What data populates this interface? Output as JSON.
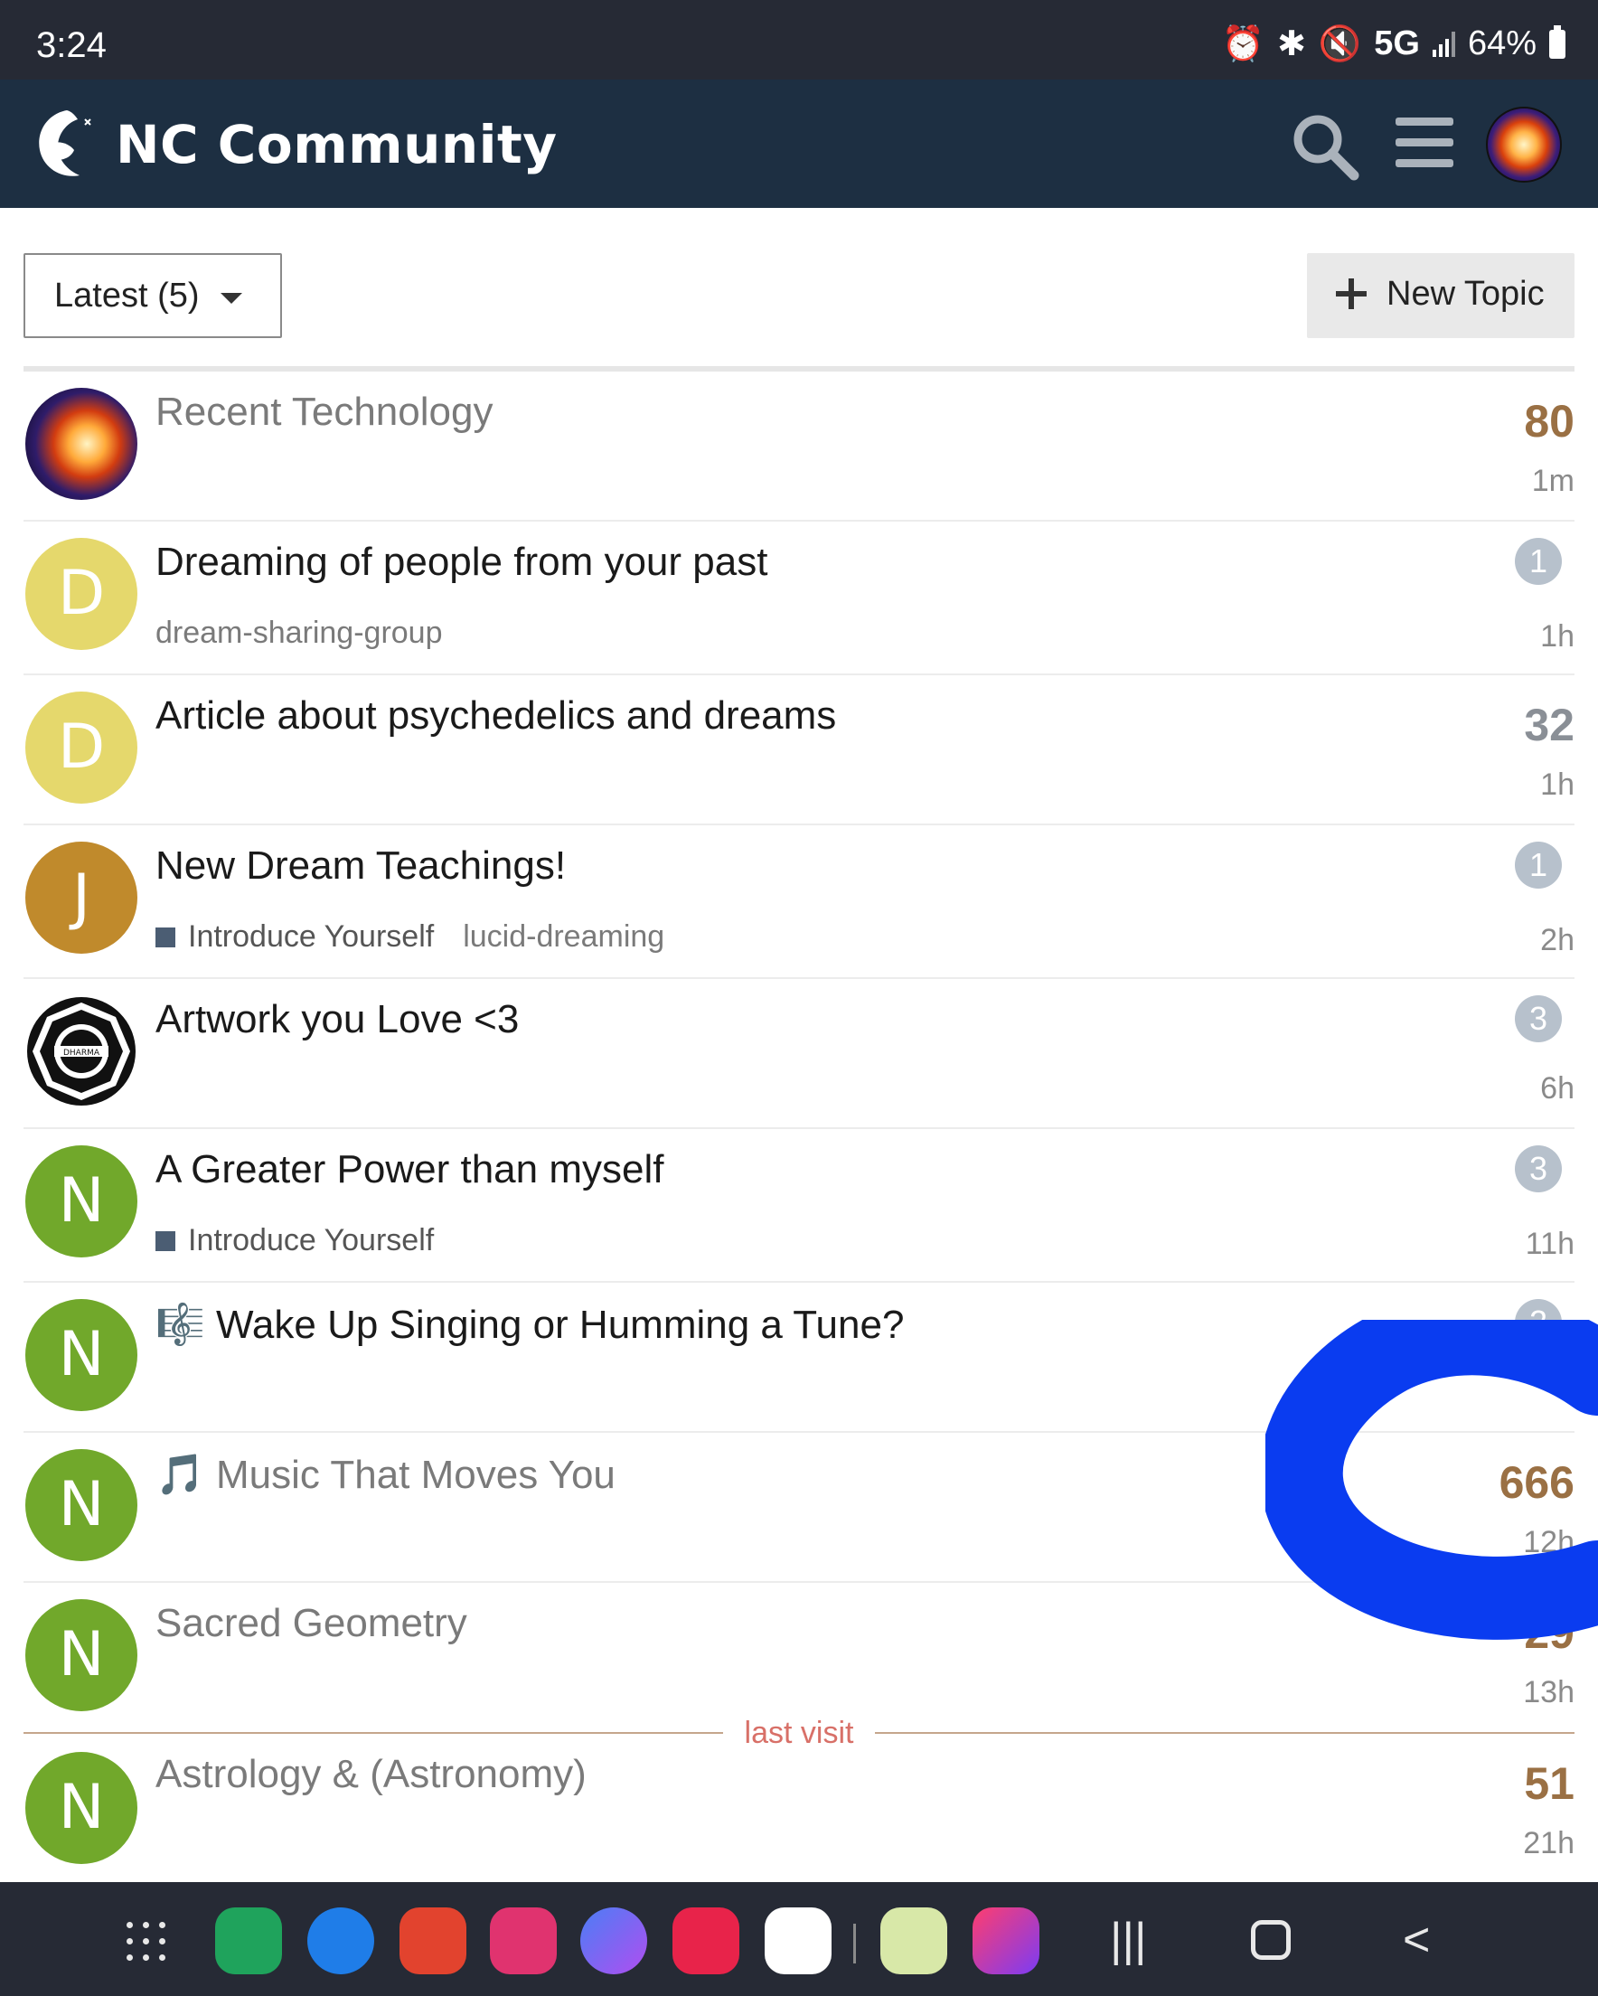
{
  "status_bar": {
    "time": "3:24",
    "network": "5G",
    "battery": "64%"
  },
  "header": {
    "title": "NC Community"
  },
  "controls": {
    "filter_label": "Latest (5)",
    "new_topic_label": "New Topic"
  },
  "topics": [
    {
      "title": "Recent Technology",
      "category": "",
      "tags": "",
      "count": "80",
      "count_color": "#9a7044",
      "badge": "",
      "age": "1m",
      "read": true
    },
    {
      "title": "Dreaming of people from your past",
      "category": "",
      "tags": "dream-sharing-group",
      "count": "",
      "badge": "1",
      "age": "1h",
      "read": false,
      "avatar_letter": "D"
    },
    {
      "title": "Article about psychedelics and dreams",
      "category": "",
      "tags": "",
      "count": "32",
      "count_color": "#8a8f96",
      "badge": "",
      "age": "1h",
      "read": false,
      "avatar_letter": "D"
    },
    {
      "title": "New Dream Teachings!",
      "category": "Introduce Yourself",
      "tags": "lucid-dreaming",
      "count": "",
      "badge": "1",
      "age": "2h",
      "read": false,
      "avatar_letter": "J"
    },
    {
      "title": "Artwork you Love <3",
      "category": "",
      "tags": "",
      "count": "",
      "badge": "3",
      "age": "6h",
      "read": false
    },
    {
      "title": "A Greater Power than myself",
      "category": "Introduce Yourself",
      "tags": "",
      "count": "",
      "badge": "3",
      "age": "11h",
      "read": false,
      "avatar_letter": "N"
    },
    {
      "title": "Wake Up Singing or Humming a Tune?",
      "category": "",
      "tags": "",
      "count": "",
      "badge": "2",
      "age": "",
      "read": false,
      "avatar_letter": "N"
    },
    {
      "title": "Music That Moves You",
      "category": "",
      "tags": "",
      "count": "666",
      "count_color": "#9a7044",
      "badge": "",
      "age": "12h",
      "read": true,
      "avatar_letter": "N"
    },
    {
      "title": "Sacred Geometry",
      "category": "",
      "tags": "",
      "count": "29",
      "count_color": "#9a7044",
      "badge": "",
      "age": "13h",
      "read": true,
      "avatar_letter": "N"
    },
    {
      "title": "Astrology & (Astronomy)",
      "category": "",
      "tags": "",
      "count": "51",
      "count_color": "#9a7044",
      "badge": "",
      "age": "21h",
      "read": true,
      "avatar_letter": "N"
    }
  ],
  "last_visit_label": "last visit",
  "avatar_colors": {
    "D": "#e5d86c",
    "J": "#c08a2c",
    "N": "#71a82b"
  },
  "icons": {
    "wake_up_emoji": "🎼",
    "music_emoji": "🎵"
  }
}
